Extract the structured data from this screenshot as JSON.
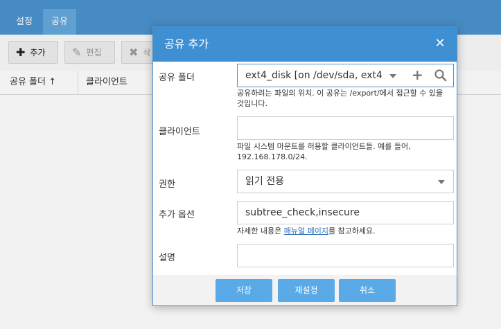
{
  "app": {
    "tabs": [
      {
        "label": "설정"
      },
      {
        "label": "공유"
      }
    ],
    "toolbar": {
      "add_label": "추가",
      "edit_label": "편집",
      "delete_label": "삭"
    },
    "table": {
      "columns": [
        "공유 폴더",
        "클라이언트"
      ],
      "sort_indicator": "↑"
    }
  },
  "dialog": {
    "title": "공유 추가",
    "fields": {
      "shared_folder": {
        "label": "공유 폴더",
        "value": "ext4_disk [on /dev/sda, ext4",
        "hint": "공유하려는 파일의 위치. 이 공유는 /export/에서 접근할 수 있을 것입니다."
      },
      "client": {
        "label": "클라이언트",
        "value": "",
        "hint": "파일 시스템 마운트를 허용할 클라이언트들. 예를 들어, 192.168.178.0/24."
      },
      "permission": {
        "label": "권한",
        "value": "읽기 전용"
      },
      "extra_options": {
        "label": "추가 옵션",
        "value": "subtree_check,insecure",
        "hint_prefix": "자세한 내용은 ",
        "hint_link": "매뉴얼 페이지",
        "hint_suffix": "를 참고하세요."
      },
      "description": {
        "label": "설명",
        "value": ""
      }
    },
    "buttons": {
      "save": "저장",
      "reset": "재설정",
      "cancel": "취소"
    }
  },
  "colors": {
    "header": "#4b93cf",
    "dialog_header": "#3f8fd3",
    "button": "#5aaae8",
    "link": "#2a6fb5"
  },
  "icons": {
    "add": "plus-icon",
    "edit": "pencil-icon",
    "delete": "x-icon",
    "close": "close-icon",
    "dropdown": "caret-down-icon",
    "search": "search-icon"
  }
}
